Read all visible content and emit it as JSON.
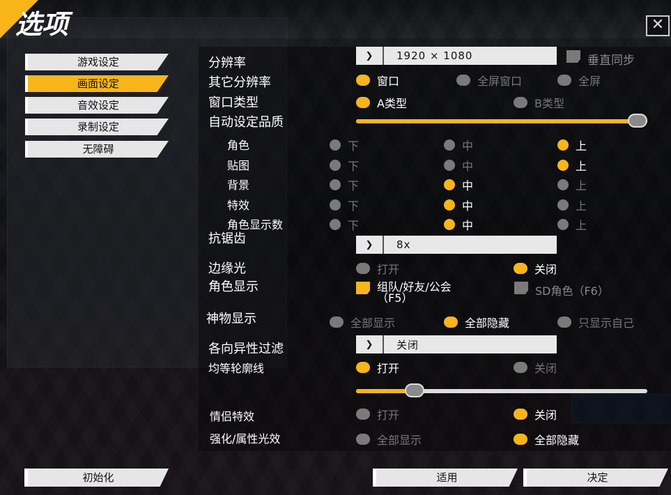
{
  "title": "选项",
  "close_glyph": "✕",
  "sidebar": {
    "items": [
      {
        "label": "游戏设定",
        "active": false
      },
      {
        "label": "画面设定",
        "active": true
      },
      {
        "label": "音效设定",
        "active": false
      },
      {
        "label": "录制设定",
        "active": false
      },
      {
        "label": "无障碍",
        "active": false
      }
    ]
  },
  "settings": {
    "resolution": {
      "label": "分辨率",
      "value": "1920 × 1080",
      "vsync_label": "垂直同步",
      "vsync_checked": false
    },
    "other_resolution": {
      "label": "其它分辨率",
      "options": [
        "窗口",
        "全屏窗口",
        "全屏"
      ],
      "selected": 0
    },
    "window_type": {
      "label": "窗口类型",
      "options": [
        "A类型",
        "B类型"
      ],
      "selected": 0
    },
    "auto_quality": {
      "label": "自动设定品质",
      "value_fraction": 1.0
    },
    "quality_levels": [
      "下",
      "中",
      "上"
    ],
    "quality_rows": [
      {
        "label": "角色",
        "selected": 2
      },
      {
        "label": "贴图",
        "selected": 2
      },
      {
        "label": "背景",
        "selected": 1
      },
      {
        "label": "特效",
        "selected": 1
      },
      {
        "label": "角色显示数",
        "selected": 1
      }
    ],
    "antialias": {
      "label": "抗锯齿",
      "value": "8x"
    },
    "edge_light": {
      "label": "边缘光",
      "options": [
        "打开",
        "关闭"
      ],
      "selected": 1
    },
    "character_display": {
      "label": "角色显示",
      "party_label": "组队/好友/公会",
      "party_sub": "（F5）",
      "party_checked": true,
      "sd_label": "SD角色（F6）",
      "sd_checked": false
    },
    "artifact_display": {
      "label": "神物显示",
      "options": [
        "全部显示",
        "全部隐藏",
        "只显示自己"
      ],
      "selected": 1
    },
    "anisotropic": {
      "label": "各向异性过滤",
      "value": "关闭"
    },
    "isometric_outline": {
      "label": "均等轮廓线",
      "options": [
        "打开",
        "关闭"
      ],
      "selected": 0,
      "slider_fraction": 0.2
    },
    "couple_effect": {
      "label": "情侣特效",
      "options": [
        "打开",
        "关闭"
      ],
      "selected": 1
    },
    "enhance_glow": {
      "label": "强化/属性光效",
      "options": [
        "全部显示",
        "全部隐藏"
      ],
      "selected": 1
    }
  },
  "buttons": {
    "reset": "初始化",
    "apply": "适用",
    "confirm": "决定"
  }
}
